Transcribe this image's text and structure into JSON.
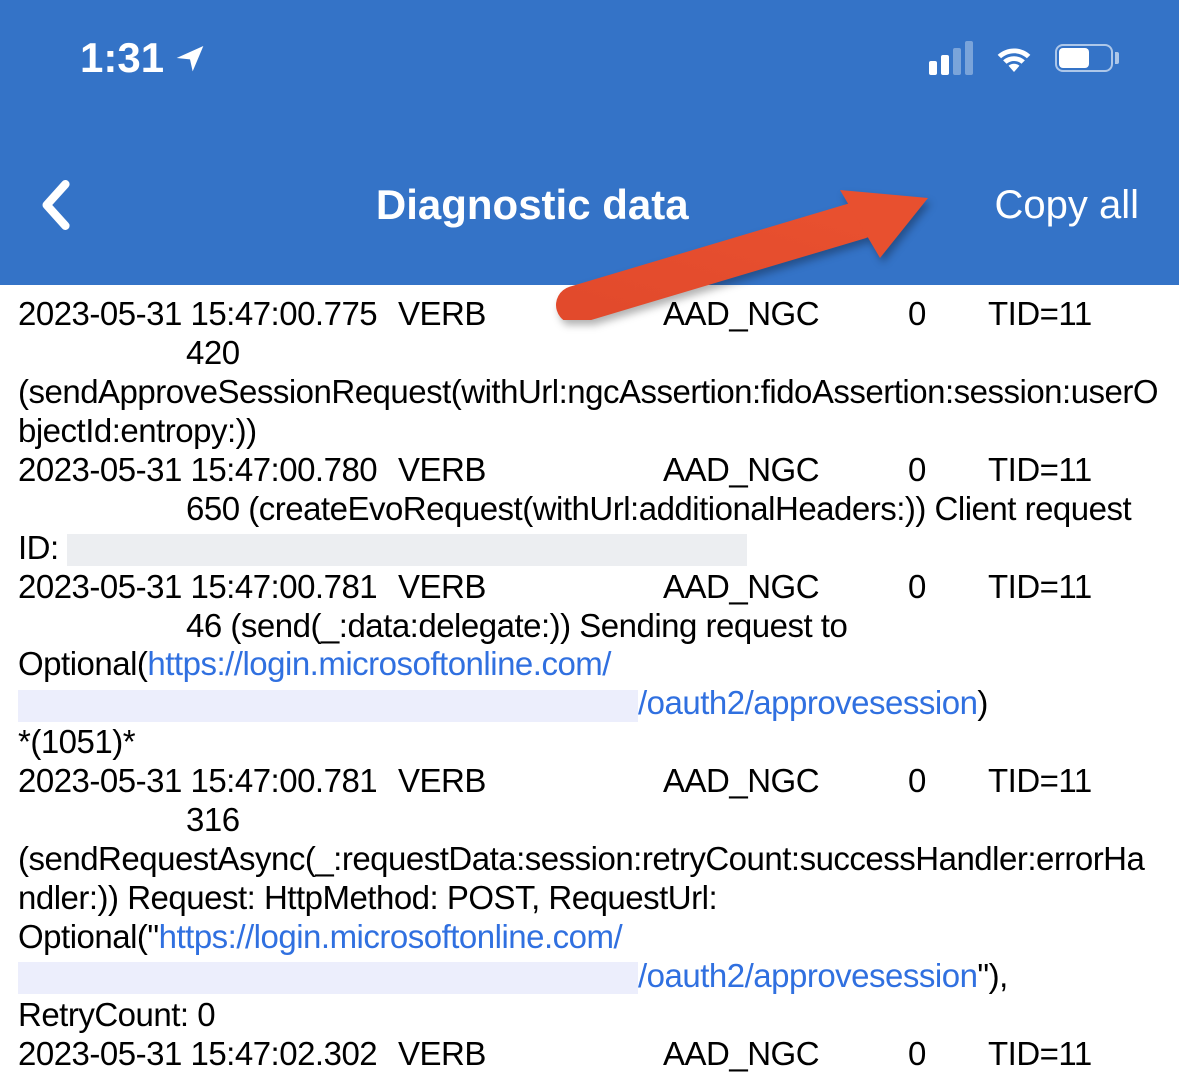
{
  "statusBar": {
    "time": "1:31"
  },
  "nav": {
    "title": "Diagnostic data",
    "copyAll": "Copy all"
  },
  "logs": [
    {
      "ts": "2023-05-31 15:47:00.775",
      "level": "VERB",
      "tag": "AAD_NGC",
      "code": "0",
      "tid": "TID=11",
      "line": "420",
      "msgText": "(sendApproveSessionRequest(withUrl:ngcAssertion:fidoAssertion:session:userObjectId:entropy:))"
    },
    {
      "ts": "2023-05-31 15:47:00.780",
      "level": "VERB",
      "tag": "AAD_NGC",
      "code": "0",
      "tid": "TID=11",
      "line": "650",
      "msgPrefix": "(createEvoRequest(withUrl:additionalHeaders:)) Client request ID:"
    },
    {
      "ts": "2023-05-31 15:47:00.781",
      "level": "VERB",
      "tag": "AAD_NGC",
      "code": "0",
      "tid": "TID=11",
      "line": "46",
      "msgPrefix": "(send(_:data:delegate:)) Sending request to Optional(",
      "link1a": "https://login.microsoftonline.com/",
      "link1b": "/oauth2/approvesession",
      "msgSuffix": ")",
      "tail": "*(1051)*"
    },
    {
      "ts": "2023-05-31 15:47:00.781",
      "level": "VERB",
      "tag": "AAD_NGC",
      "code": "0",
      "tid": "TID=11",
      "line": "316",
      "msgPrefix": "(sendRequestAsync(_:requestData:session:retryCount:successHandler:errorHandler:)) Request: HttpMethod: POST, RequestUrl: Optional(\"",
      "link1a": "https://login.microsoftonline.com/",
      "link1b": "/oauth2/approvesession",
      "msgSuffix": "\"), RetryCount: 0"
    },
    {
      "ts": "2023-05-31 15:47:02.302",
      "level": "VERB",
      "tag": "AAD_NGC",
      "code": "0",
      "tid": "TID=11"
    }
  ]
}
